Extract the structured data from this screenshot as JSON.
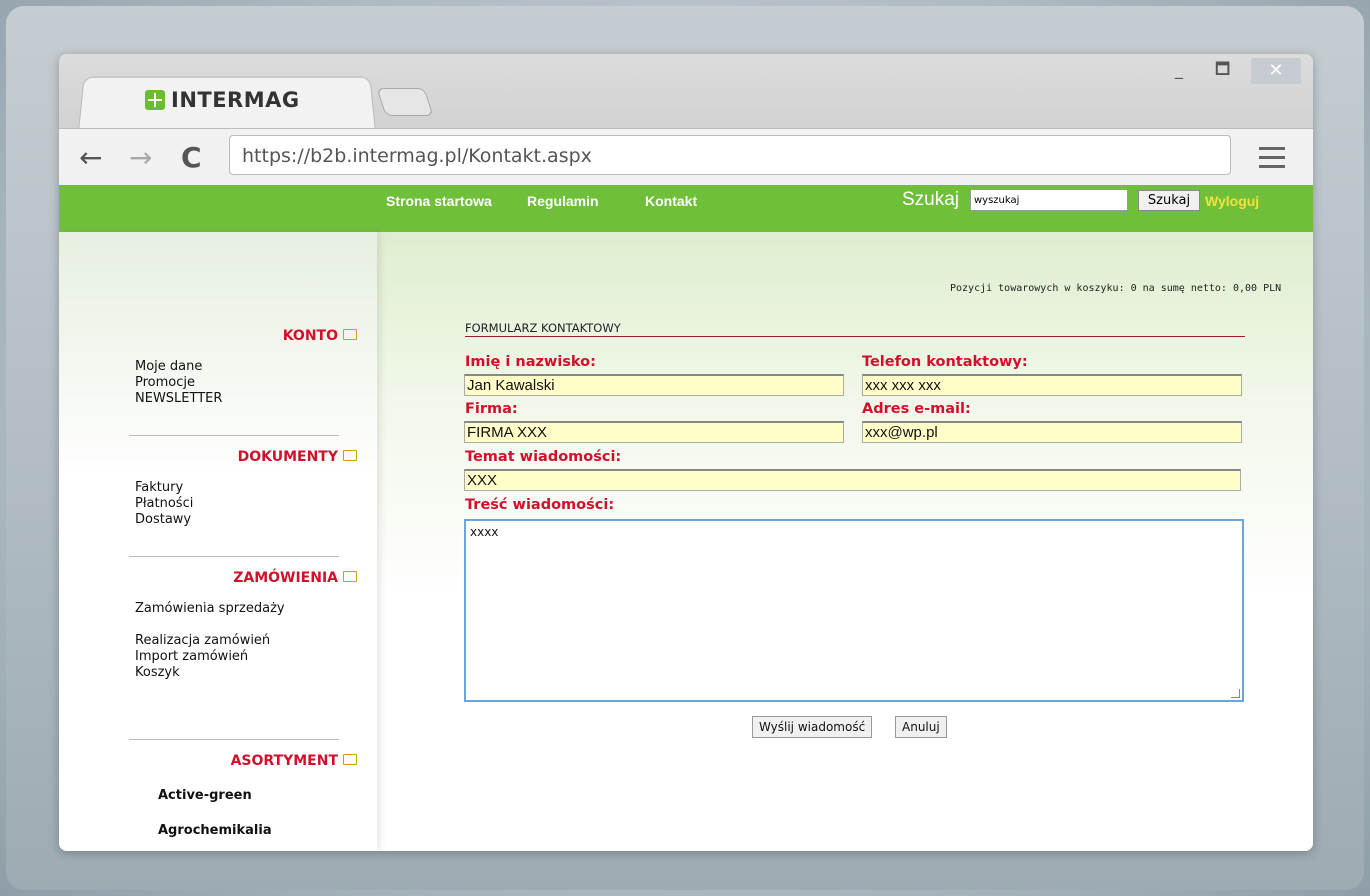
{
  "browser": {
    "tab_logo_text": "INTERMAG",
    "url": "https://b2b.intermag.pl/Kontakt.aspx",
    "min_glyph": "_",
    "max_glyph": "🗖",
    "close_glyph": "✕"
  },
  "nav": {
    "items": [
      "Strona startowa",
      "Regulamin",
      "Kontakt"
    ],
    "search_label": "Szukaj",
    "search_value": "wyszukaj",
    "search_button": "Szukaj",
    "logout": "Wyloguj"
  },
  "sidebar": {
    "sections": [
      {
        "title": "KONTO",
        "links": [
          "Moje dane",
          "Promocje",
          "NEWSLETTER"
        ]
      },
      {
        "title": "DOKUMENTY",
        "links": [
          "Faktury",
          "Płatności",
          "Dostawy"
        ]
      },
      {
        "title": "ZAMÓWIENIA",
        "links": [
          "Zamówienia sprzedaży",
          "Realizacja zamówień",
          "Import zamówień",
          "Koszyk"
        ]
      },
      {
        "title": "ASORTYMENT",
        "links": [
          "Active-green",
          "Agrochemikalia"
        ]
      }
    ]
  },
  "main": {
    "cart_info": "Pozycji towarowych w koszyku: 0 na sumę netto: 0,00 PLN",
    "form_title": "FORMULARZ KONTAKTOWY",
    "fields": {
      "name_label": "Imię i nazwisko:",
      "name_value": "Jan Kawalski",
      "phone_label": "Telefon kontaktowy:",
      "phone_value": "xxx xxx xxx",
      "company_label": "Firma:",
      "company_value": "FIRMA XXX",
      "email_label": "Adres e-mail:",
      "email_value": "xxx@wp.pl",
      "subject_label": "Temat wiadomości:",
      "subject_value": "XXX",
      "message_label": "Treść wiadomości:",
      "message_value": "xxxx"
    },
    "send_button": "Wyślij wiadomość",
    "cancel_button": "Anuluj"
  },
  "colors": {
    "nav_green": "#70bf3a",
    "accent_red": "#d0112b",
    "input_yellow": "#fffec8",
    "logout_yellow": "#f4e23a"
  }
}
